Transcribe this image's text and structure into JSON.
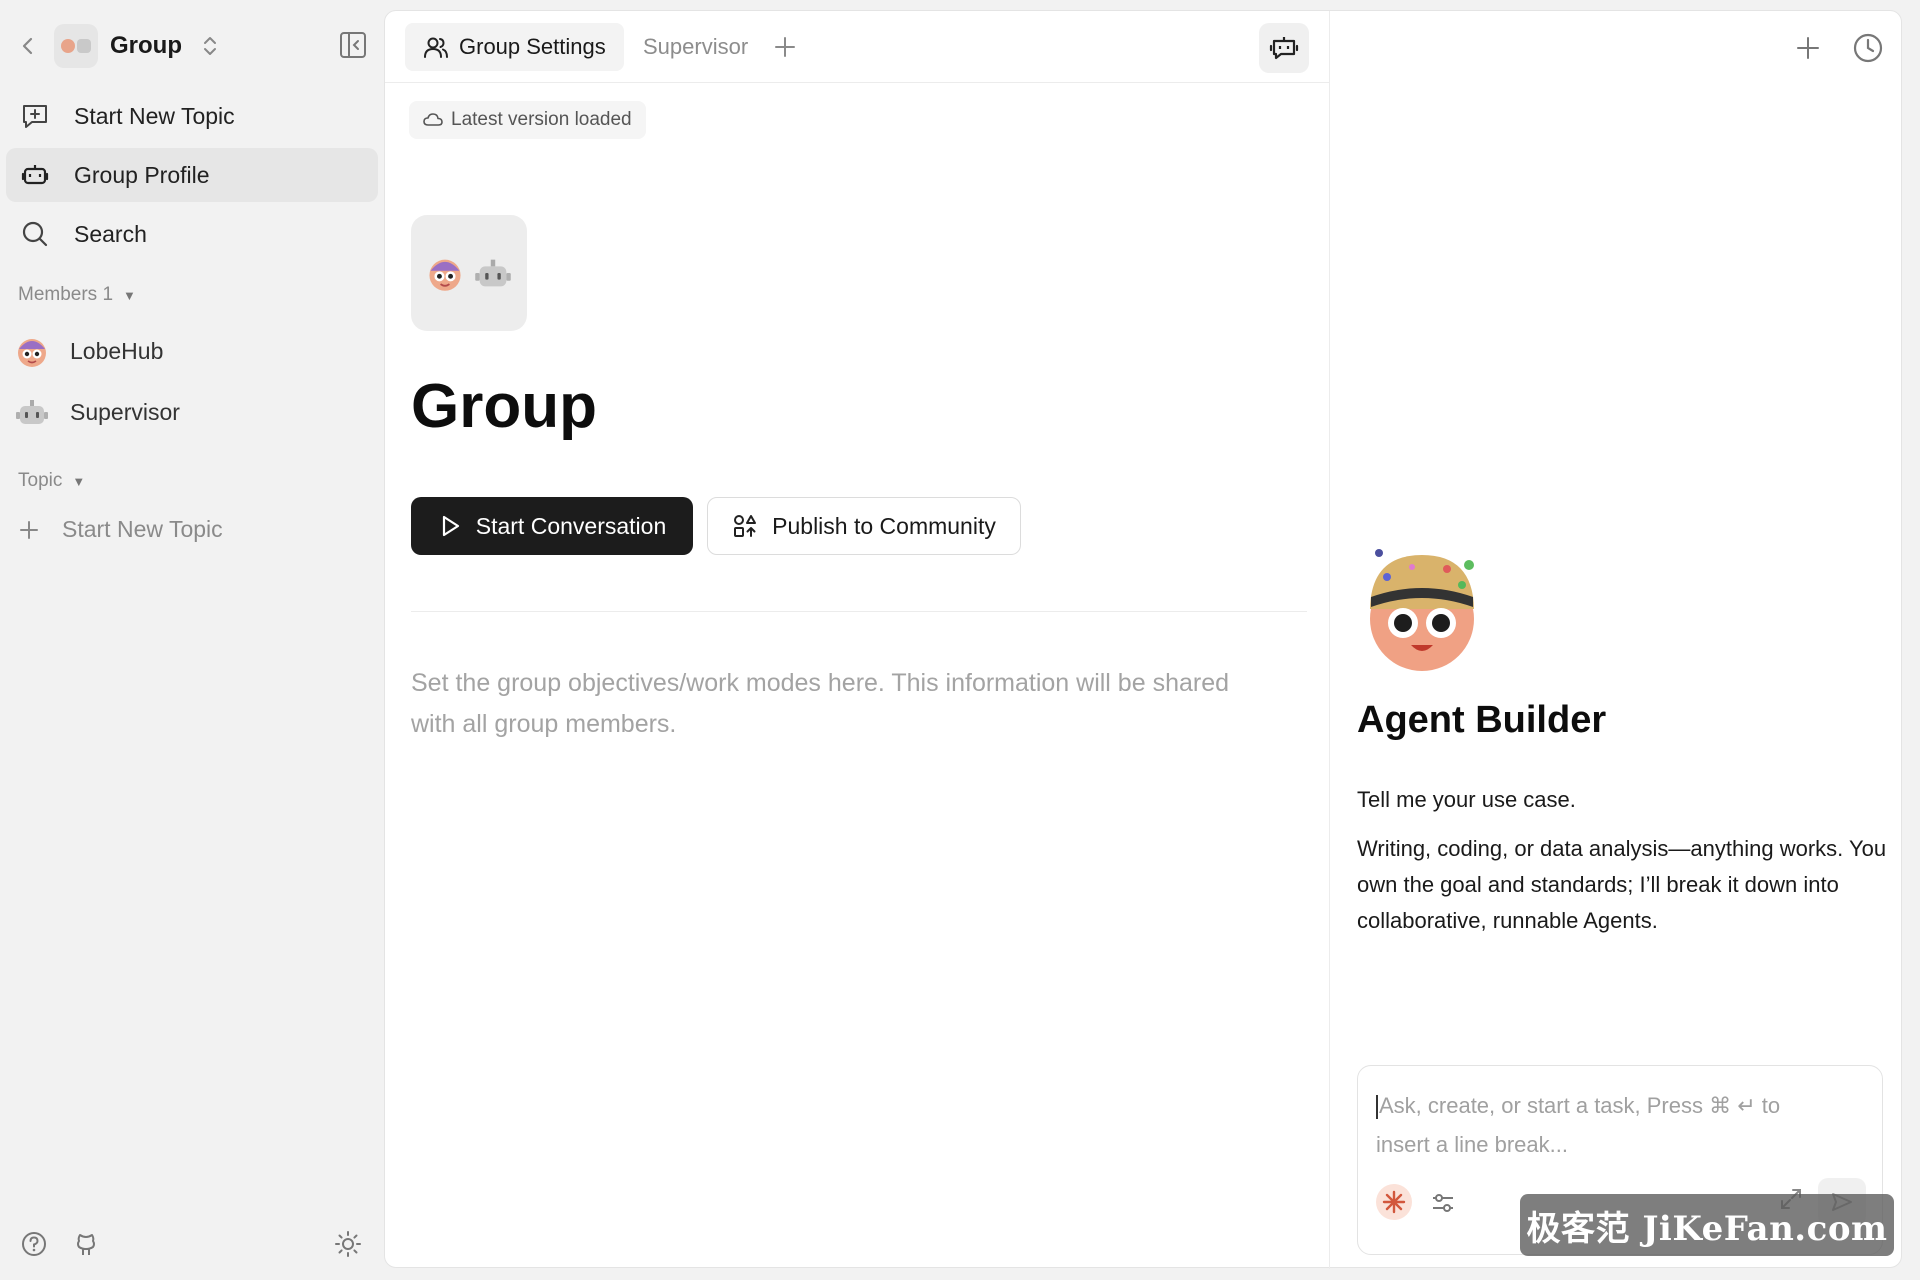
{
  "colors": {
    "accent_dark": "#1c1c1c",
    "sidebar_bg": "#f2f2f2",
    "panel_bg": "#ffffff",
    "muted_text": "#8a8a8a"
  },
  "sidebar": {
    "group_name": "Group",
    "nav": [
      {
        "label": "Start New Topic",
        "icon": "new-topic-icon"
      },
      {
        "label": "Group Profile",
        "icon": "group-profile-icon",
        "active": true
      },
      {
        "label": "Search",
        "icon": "search-icon"
      }
    ],
    "members_label": "Members 1",
    "members": [
      {
        "name": "LobeHub",
        "icon": "lobehub-avatar"
      },
      {
        "name": "Supervisor",
        "icon": "robot-avatar"
      }
    ],
    "topic_label": "Topic",
    "topic_new_label": "Start New Topic"
  },
  "main": {
    "tabs": [
      {
        "label": "Group Settings",
        "active": true
      },
      {
        "label": "Supervisor",
        "active": false
      }
    ],
    "status": "Latest version loaded",
    "title": "Group",
    "primary_button": "Start Conversation",
    "secondary_button": "Publish to Community",
    "description_placeholder": "Set the group objectives/work modes here. This information will be shared with all group members."
  },
  "builder": {
    "title": "Agent Builder",
    "intro": "Tell me your use case.",
    "description": "Writing, coding, or data analysis—anything works. You own the goal and standards; I’ll break it down into collaborative, runnable Agents.",
    "input_placeholder": "Ask, create, or start a task, Press ⌘ ↵ to insert a line break..."
  },
  "watermark": "极客范 JiKeFan.com"
}
